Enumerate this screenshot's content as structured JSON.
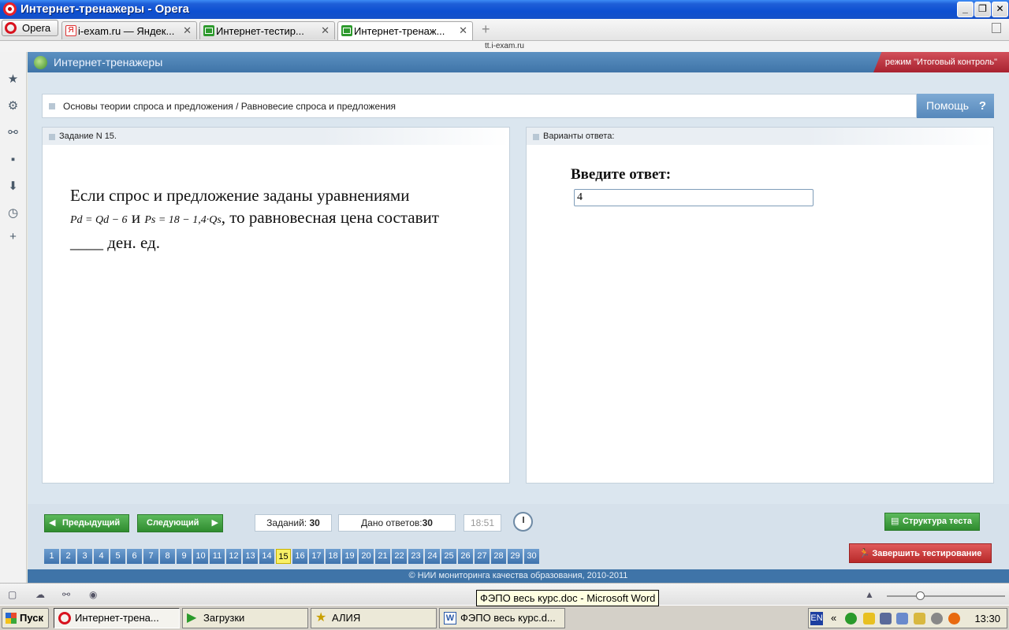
{
  "window": {
    "title": "Интернет-тренажеры - Opera"
  },
  "browser": {
    "menu_label": "Opera",
    "tabs": [
      {
        "label": "i-exam.ru — Яндек...",
        "favicon": "yandex-icon"
      },
      {
        "label": "Интернет-тестир...",
        "favicon": "envelope-icon"
      },
      {
        "label": "Интернет-тренаж...",
        "favicon": "envelope-icon",
        "active": true
      }
    ],
    "url": "tt.i-exam.ru"
  },
  "app": {
    "title": "Интернет-тренажеры",
    "mode": "режим \"Итоговый контроль\"",
    "topic": "Основы теории спроса и предложения / Равновесие спроса и предложения",
    "help_label": "Помощь",
    "help_q": "?"
  },
  "task": {
    "header": "Задание N 15.",
    "text_line1": "Если спрос и предложение заданы уравнениями",
    "formula_demand": "Pd = Qd − 6",
    "conj": "и",
    "formula_supply": "Ps = 18 − 1,4·Qs",
    "text_line2": ", то равновесная цена составит",
    "text_line3": "____ ден. ед."
  },
  "answer": {
    "header": "Варианты ответа:",
    "prompt": "Введите ответ:",
    "value": "4"
  },
  "controls": {
    "prev": "Предыдущий",
    "next": "Следующий",
    "tasks_label": "Заданий:",
    "tasks_count": "30",
    "answers_label": "Дано ответов:",
    "answers_count": "30",
    "timer": "18:51",
    "structure": "Структура теста",
    "finish": "Завершить тестирование"
  },
  "pages": [
    "1",
    "2",
    "3",
    "4",
    "5",
    "6",
    "7",
    "8",
    "9",
    "10",
    "11",
    "12",
    "13",
    "14",
    "15",
    "16",
    "17",
    "18",
    "19",
    "20",
    "21",
    "22",
    "23",
    "24",
    "25",
    "26",
    "27",
    "28",
    "29",
    "30"
  ],
  "current_page": "15",
  "footer": "© НИИ мониторинга качества образования, 2010-2011",
  "tooltip": "ФЭПО весь курс.doc - Microsoft Word",
  "taskbar": {
    "start": "Пуск",
    "items": [
      "Интернет-трена...",
      "Загрузки",
      "АЛИЯ",
      "ФЭПО весь курс.d..."
    ],
    "lang": "EN",
    "clock": "13:30"
  },
  "colors": {
    "accent": "#3f74a8",
    "mode_red": "#b82a2a",
    "green_btn": "#3a9a3a",
    "current_page": "#f8f066"
  }
}
